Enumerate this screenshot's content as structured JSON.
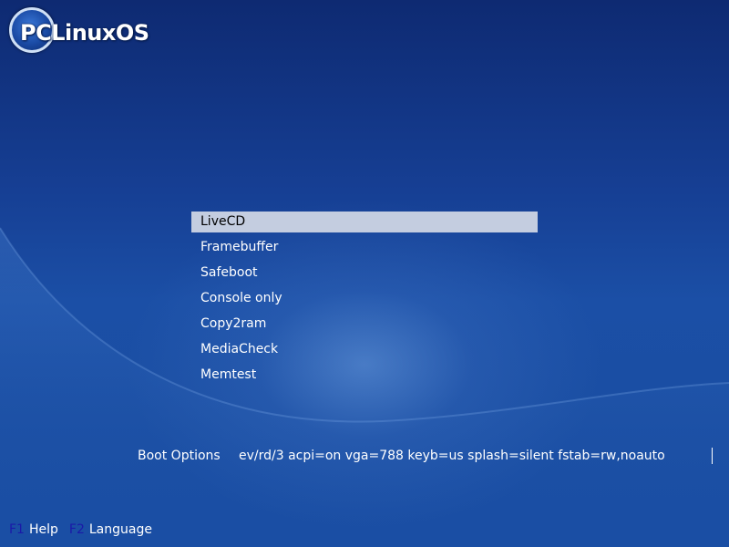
{
  "logo": {
    "text": "PCLinuxOS"
  },
  "menu": {
    "items": [
      {
        "label": "LiveCD",
        "selected": true
      },
      {
        "label": "Framebuffer",
        "selected": false
      },
      {
        "label": "Safeboot",
        "selected": false
      },
      {
        "label": "Console only",
        "selected": false
      },
      {
        "label": "Copy2ram",
        "selected": false
      },
      {
        "label": "MediaCheck",
        "selected": false
      },
      {
        "label": "Memtest",
        "selected": false
      }
    ]
  },
  "boot_options": {
    "label": "Boot Options",
    "value": "ev/rd/3 acpi=on vga=788 keyb=us splash=silent fstab=rw,noauto"
  },
  "footer": {
    "keys": [
      {
        "key": "F1",
        "label": "Help"
      },
      {
        "key": "F2",
        "label": "Language"
      }
    ]
  },
  "colors": {
    "background": "#1a4ea3",
    "selection_bar": "#c4cde0",
    "function_key": "#1a1aa8",
    "text": "#ffffff"
  }
}
